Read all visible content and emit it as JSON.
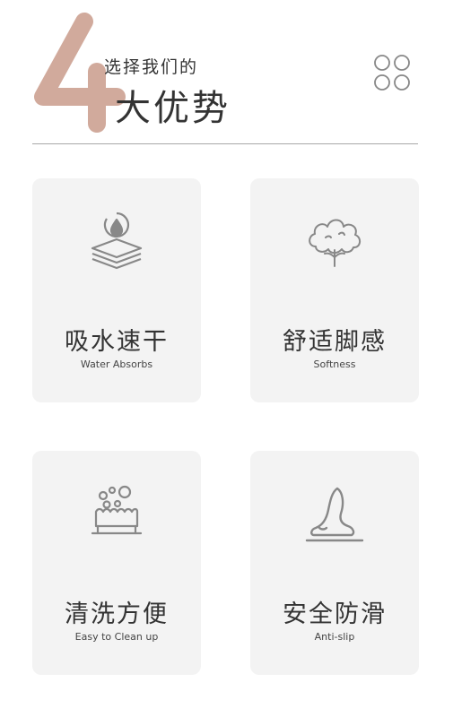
{
  "header": {
    "number": "4",
    "subtitle": "选择我们的",
    "title": "大优势",
    "accent_color": "#d1aa9c",
    "menu_icon": "grid-four-circles-icon"
  },
  "features": [
    {
      "title": "吸水速干",
      "subtitle": "Water Absorbs",
      "icon": "water-drop-layers-icon"
    },
    {
      "title": "舒适脚感",
      "subtitle": "Softness",
      "icon": "cotton-plant-icon"
    },
    {
      "title": "清洗方便",
      "subtitle": "Easy to Clean up",
      "icon": "soap-bubbles-icon"
    },
    {
      "title": "安全防滑",
      "subtitle": "Anti-slip",
      "icon": "foot-icon"
    }
  ]
}
